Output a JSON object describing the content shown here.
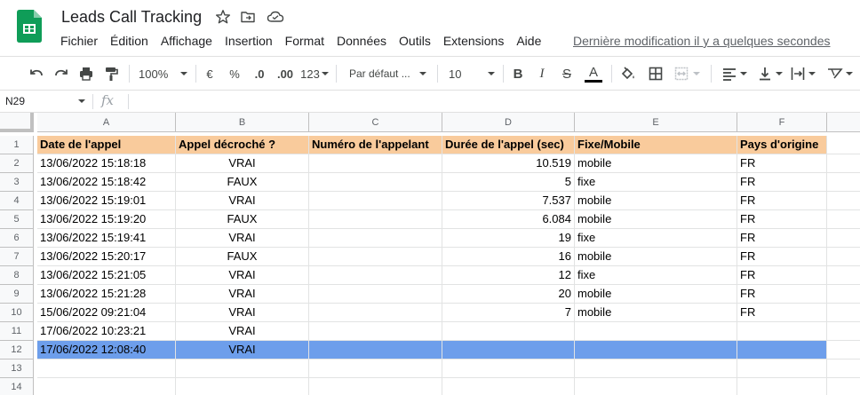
{
  "app": {
    "title": "Leads Call Tracking",
    "last_edit": "Dernière modification il y a quelques secondes",
    "brand_color": "#0f9d58"
  },
  "menu": [
    "Fichier",
    "Édition",
    "Affichage",
    "Insertion",
    "Format",
    "Données",
    "Outils",
    "Extensions",
    "Aide"
  ],
  "toolbar": {
    "zoom": "100%",
    "currency": "€",
    "percent": "%",
    "dec_decrease": ".0",
    "dec_increase": ".00",
    "more_formats": "123",
    "font": "Par défaut ...",
    "font_size": "10",
    "bold": "B",
    "italic": "I",
    "strike": "S",
    "text_color_label": "A",
    "icons": [
      "undo-icon",
      "redo-icon",
      "print-icon",
      "paint-format-icon",
      "fill-color-icon",
      "borders-icon",
      "merge-icon",
      "align-icon",
      "valign-icon",
      "wrap-icon",
      "rotate-icon"
    ]
  },
  "formula_bar": {
    "name_box": "N29",
    "fx": "fx",
    "formula": ""
  },
  "sheet": {
    "columns": [
      "A",
      "B",
      "C",
      "D",
      "E",
      "F"
    ],
    "row_numbers": [
      "1",
      "2",
      "3",
      "4",
      "5",
      "6",
      "7",
      "8",
      "9",
      "10",
      "11",
      "12",
      "13",
      "14"
    ],
    "header_color": "#f9cb9c",
    "selected_row_color": "#6d9eeb",
    "selected_row": "12",
    "rows": [
      [
        "Date de l'appel",
        "Appel décroché ?",
        "Numéro de l'appelant",
        "Durée de l'appel (sec)",
        "Fixe/Mobile",
        "Pays d'origine"
      ],
      [
        "13/06/2022 15:18:18",
        "VRAI",
        "",
        "10.519",
        "mobile",
        "FR"
      ],
      [
        "13/06/2022 15:18:42",
        "FAUX",
        "",
        "5",
        "fixe",
        "FR"
      ],
      [
        "13/06/2022 15:19:01",
        "VRAI",
        "",
        "7.537",
        "mobile",
        "FR"
      ],
      [
        "13/06/2022 15:19:20",
        "FAUX",
        "",
        "6.084",
        "mobile",
        "FR"
      ],
      [
        "13/06/2022 15:19:41",
        "VRAI",
        "",
        "19",
        "fixe",
        "FR"
      ],
      [
        "13/06/2022 15:20:17",
        "FAUX",
        "",
        "16",
        "mobile",
        "FR"
      ],
      [
        "13/06/2022 15:21:05",
        "VRAI",
        "",
        "12",
        "fixe",
        "FR"
      ],
      [
        "13/06/2022 15:21:28",
        "VRAI",
        "",
        "20",
        "mobile",
        "FR"
      ],
      [
        "15/06/2022 09:21:04",
        "VRAI",
        "",
        "7",
        "mobile",
        "FR"
      ],
      [
        "17/06/2022 10:23:21",
        "VRAI",
        "",
        "",
        "",
        ""
      ],
      [
        "17/06/2022 12:08:40",
        "VRAI",
        "",
        "",
        "",
        ""
      ],
      [
        "",
        "",
        "",
        "",
        "",
        ""
      ],
      [
        "",
        "",
        "",
        "",
        "",
        ""
      ]
    ]
  }
}
